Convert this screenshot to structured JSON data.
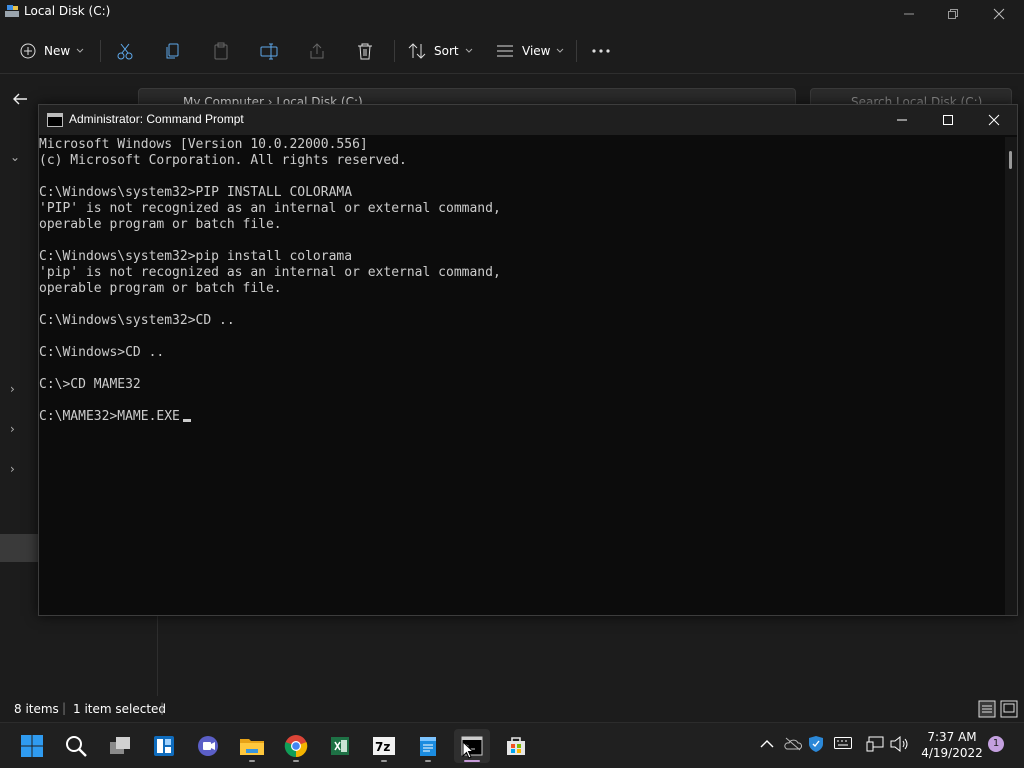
{
  "explorer": {
    "title": "Local Disk (C:)",
    "toolbar": {
      "new_label": "New",
      "sort_label": "Sort",
      "view_label": "View"
    },
    "breadcrumb": [
      "My Computer",
      "Local Disk (C:)"
    ],
    "search_placeholder": "Search Local Disk (C:)",
    "status": {
      "items": "8 items",
      "selected": "1 item selected"
    }
  },
  "cmd": {
    "title": "Administrator: Command Prompt",
    "lines": [
      "Microsoft Windows [Version 10.0.22000.556]",
      "(c) Microsoft Corporation. All rights reserved.",
      "",
      "C:\\Windows\\system32>PIP INSTALL COLORAMA",
      "'PIP' is not recognized as an internal or external command,",
      "operable program or batch file.",
      "",
      "C:\\Windows\\system32>pip install colorama",
      "'pip' is not recognized as an internal or external command,",
      "operable program or batch file.",
      "",
      "C:\\Windows\\system32>CD ..",
      "",
      "C:\\Windows>CD ..",
      "",
      "C:\\>CD MAME32",
      "",
      "C:\\MAME32>MAME.EXE"
    ]
  },
  "taskbar": {
    "apps": [
      "start",
      "search",
      "task-view",
      "widgets",
      "teams-chat",
      "file-explorer",
      "chrome",
      "excel",
      "7zip",
      "notepad",
      "terminal",
      "store"
    ],
    "seven_zip_label": "7z",
    "time": "7:37 AM",
    "date": "4/19/2022",
    "notification_count": "1"
  },
  "colors": {
    "terminal_bg": "#0c0c0c",
    "terminal_text": "#cccccc",
    "explorer_bg": "#1c1c1c",
    "taskbar_bg": "#202020",
    "accent": "#c59ad8"
  }
}
